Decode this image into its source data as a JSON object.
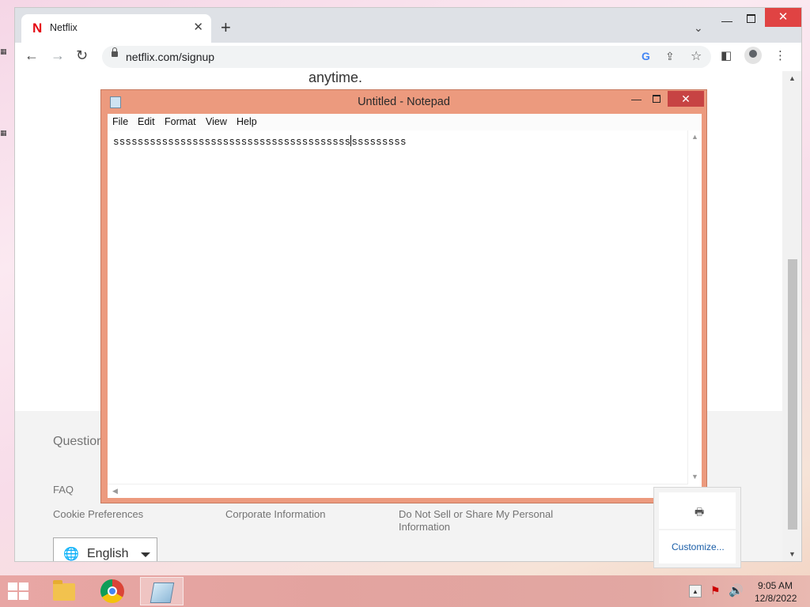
{
  "browser": {
    "tab_title": "Netflix",
    "tab_favicon": "N",
    "tab_close": "✕",
    "new_tab": "+",
    "tab_search": "⌄",
    "window_minimize": "—",
    "window_close": "✕",
    "url": "netflix.com/signup",
    "icons": {
      "back": "←",
      "forward": "→",
      "reload": "↻",
      "google": "G",
      "share": "⇪",
      "star": "☆",
      "sidepanel": "◧",
      "menu": "⋮"
    }
  },
  "page": {
    "top_text": "anytime.",
    "footer": {
      "questions": "Question",
      "faq": "FAQ",
      "cookie": "Cookie Preferences",
      "corporate": "Corporate Information",
      "do_not_sell": "Do Not Sell or Share My Personal",
      "do_not_sell_2": "Information"
    },
    "language": {
      "globe": "🌐",
      "selected": "English"
    }
  },
  "notepad": {
    "title": "Untitled - Notepad",
    "minimize": "—",
    "close": "✕",
    "menu": [
      "File",
      "Edit",
      "Format",
      "View",
      "Help"
    ],
    "text_before_caret": "sssssssssssssssssssssssssssssssssssssss",
    "text_after_caret": "sssssssss"
  },
  "tray_popup": {
    "app_icon": "🖶",
    "customize": "Customize..."
  },
  "taskbar": {
    "tray_up": "▲",
    "tray_flag": "⚑",
    "tray_volume": "🔊",
    "time": "9:05 AM",
    "date": "12/8/2022"
  }
}
